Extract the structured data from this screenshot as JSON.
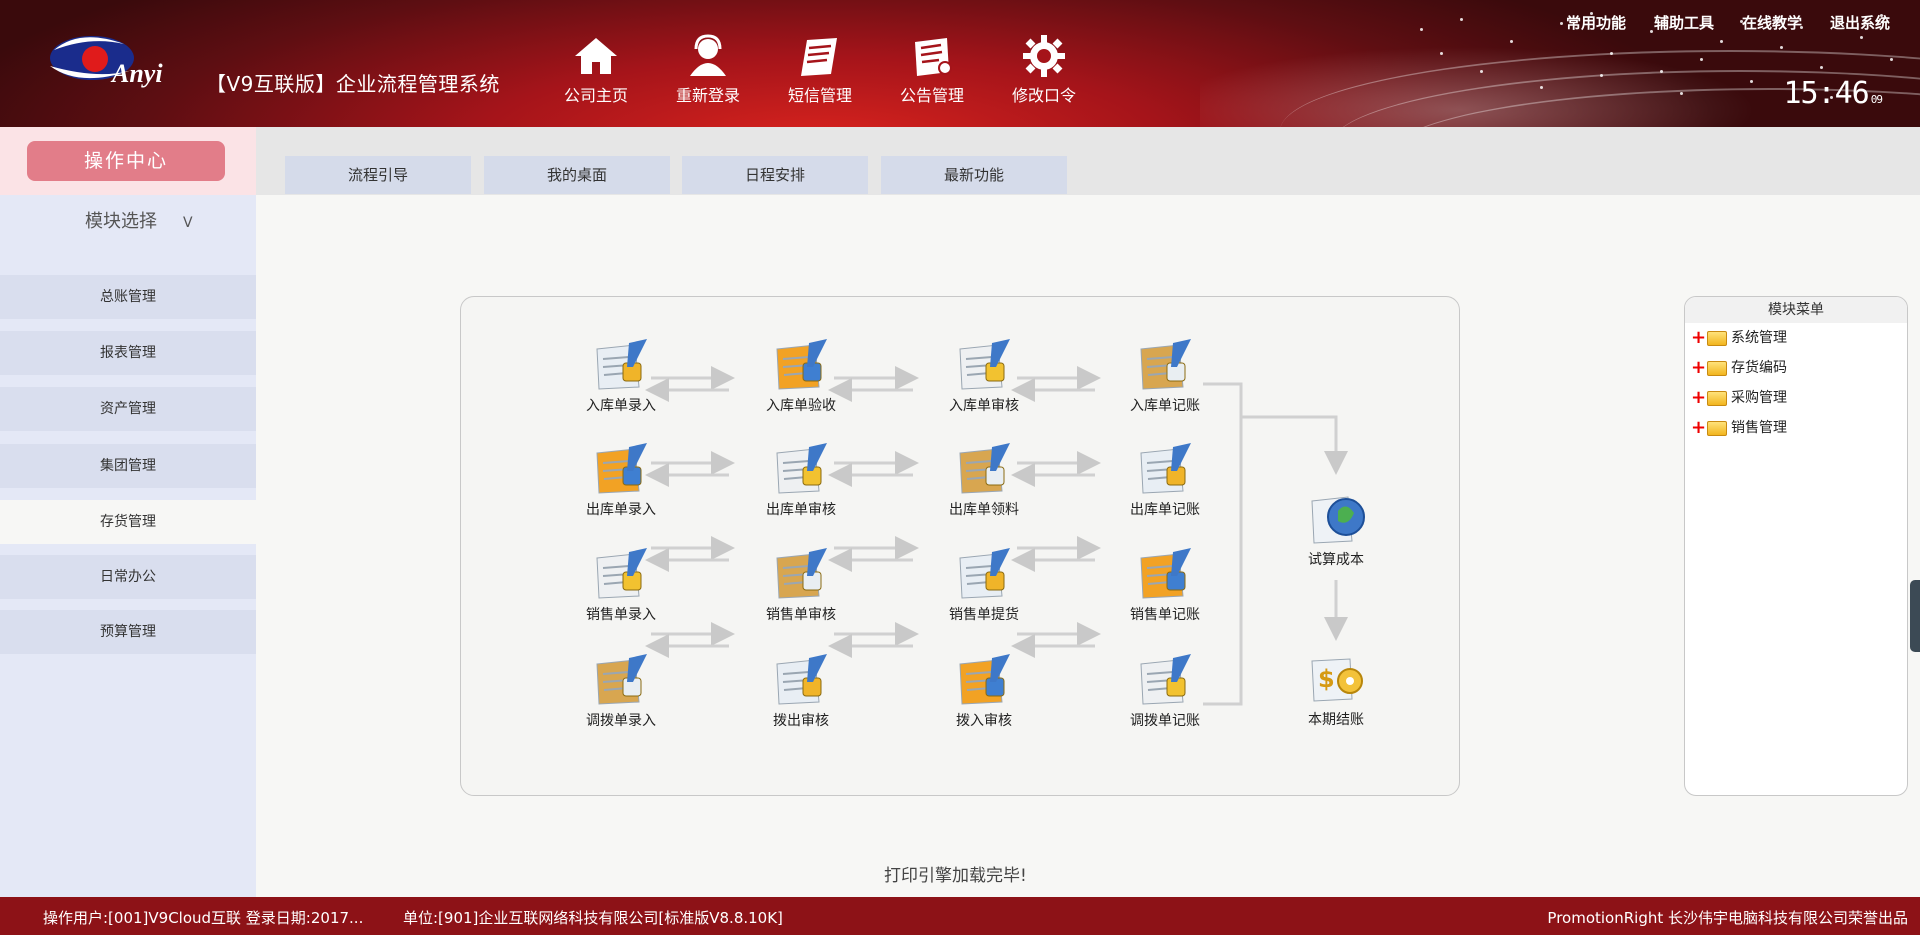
{
  "app": {
    "logo_text": "Anyi",
    "title": "【V9互联版】企业流程管理系统",
    "clock": {
      "time": "15:46",
      "seconds": "09"
    }
  },
  "top_nav": [
    {
      "label": "公司主页",
      "icon": "home-icon"
    },
    {
      "label": "重新登录",
      "icon": "user-icon"
    },
    {
      "label": "短信管理",
      "icon": "message-icon"
    },
    {
      "label": "公告管理",
      "icon": "notice-icon"
    },
    {
      "label": "修改口令",
      "icon": "gear-icon"
    }
  ],
  "top_links": [
    "常用功能",
    "辅助工具",
    "在线教学",
    "退出系统"
  ],
  "sidebar": {
    "op_center": "操作中心",
    "module_select": "模块选择",
    "module_select_caret": "V",
    "items": [
      {
        "label": "总账管理",
        "active": false
      },
      {
        "label": "报表管理",
        "active": false
      },
      {
        "label": "资产管理",
        "active": false
      },
      {
        "label": "集团管理",
        "active": false
      },
      {
        "label": "存货管理",
        "active": true
      },
      {
        "label": "日常办公",
        "active": false
      },
      {
        "label": "预算管理",
        "active": false
      }
    ]
  },
  "tabs": [
    "流程引导",
    "我的桌面",
    "日程安排",
    "最新功能"
  ],
  "flow": {
    "rows": [
      [
        "入库单录入",
        "入库单验收",
        "入库单审核",
        "入库单记账"
      ],
      [
        "出库单录入",
        "出库单审核",
        "出库单领料",
        "出库单记账"
      ],
      [
        "销售单录入",
        "销售单审核",
        "销售单提货",
        "销售单记账"
      ],
      [
        "调拨单录入",
        "拨出审核",
        "拨入审核",
        "调拨单记账"
      ]
    ],
    "side_nodes": [
      "试算成本",
      "本期结账"
    ]
  },
  "module_menu": {
    "title": "模块菜单",
    "items": [
      "系统管理",
      "存货编码",
      "采购管理",
      "销售管理"
    ]
  },
  "status_message": "打印引擎加载完毕!",
  "footer": {
    "user": "操作用户:[001]V9Cloud互联  登录日期:2017...",
    "unit": "单位:[901]企业互联网络科技有限公司[标准版V8.8.10K]",
    "credit": "PromotionRight 长沙伟宇电脑科技有限公司荣誉出品"
  },
  "colors": {
    "header_red": "#a5141a",
    "footer_red": "#8d1217",
    "op_center_pink": "#e27d89",
    "sidebar_blue": "#e4e8f6",
    "tab_blue": "#d5dbea"
  }
}
